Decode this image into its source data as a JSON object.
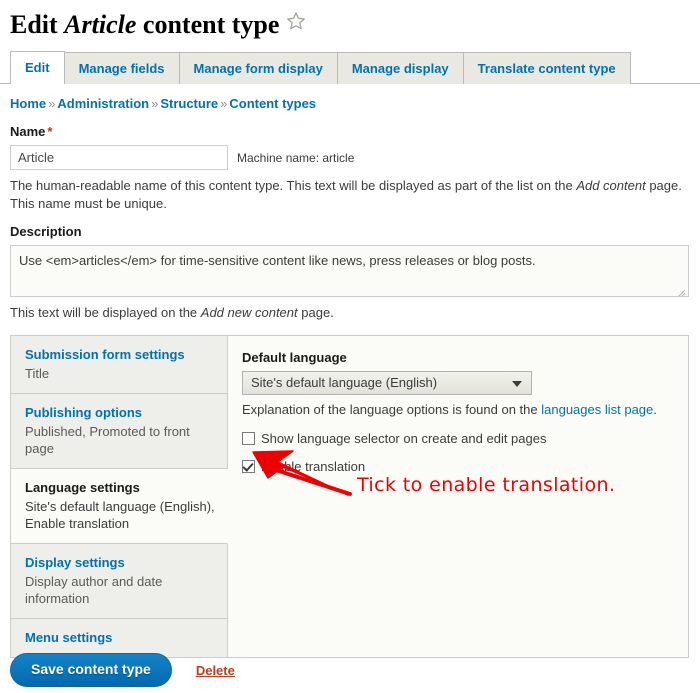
{
  "header": {
    "title_prefix": "Edit ",
    "title_emphasis": "Article",
    "title_suffix": " content type",
    "star_icon": "star-outline-icon"
  },
  "tabs": [
    {
      "label": "Edit",
      "active": true
    },
    {
      "label": "Manage fields",
      "active": false
    },
    {
      "label": "Manage form display",
      "active": false
    },
    {
      "label": "Manage display",
      "active": false
    },
    {
      "label": "Translate content type",
      "active": false
    }
  ],
  "breadcrumb": {
    "separator": "»",
    "items": [
      "Home",
      "Administration",
      "Structure",
      "Content types"
    ]
  },
  "name_field": {
    "label": "Name",
    "required_marker": "*",
    "value": "Article",
    "machine_name": "Machine name: article",
    "help_part1": "The human-readable name of this content type. This text will be displayed as part of the list on the ",
    "help_emphasis": "Add content",
    "help_part2": " page. This name must be unique."
  },
  "description_field": {
    "label": "Description",
    "value": "Use <em>articles</em> for time-sensitive content like news, press releases or blog posts.",
    "help_part1": "This text will be displayed on the ",
    "help_emphasis": "Add new content",
    "help_part2": " page."
  },
  "vertical_tabs": [
    {
      "title": "Submission form settings",
      "summary": "Title",
      "active": false
    },
    {
      "title": "Publishing options",
      "summary": "Published, Promoted to front page",
      "active": false
    },
    {
      "title": "Language settings",
      "summary": "Site's default language (English), Enable translation",
      "active": true
    },
    {
      "title": "Display settings",
      "summary": "Display author and date information",
      "active": false
    },
    {
      "title": "Menu settings",
      "summary": "",
      "active": false
    }
  ],
  "language_pane": {
    "default_language_label": "Default language",
    "default_language_value": "Site's default language (English)",
    "help_prefix": "Explanation of the language options is found on the ",
    "help_link": "languages list page",
    "help_suffix": ".",
    "show_selector_label": "Show language selector on create and edit pages",
    "show_selector_checked": false,
    "enable_translation_label": "Enable translation",
    "enable_translation_checked": true
  },
  "annotation": {
    "text": "Tick to enable translation.",
    "color": "#ee0000"
  },
  "actions": {
    "save_label": "Save content type",
    "delete_label": "Delete",
    "primary_color": "#0b76bd",
    "delete_color": "#c8391c"
  }
}
